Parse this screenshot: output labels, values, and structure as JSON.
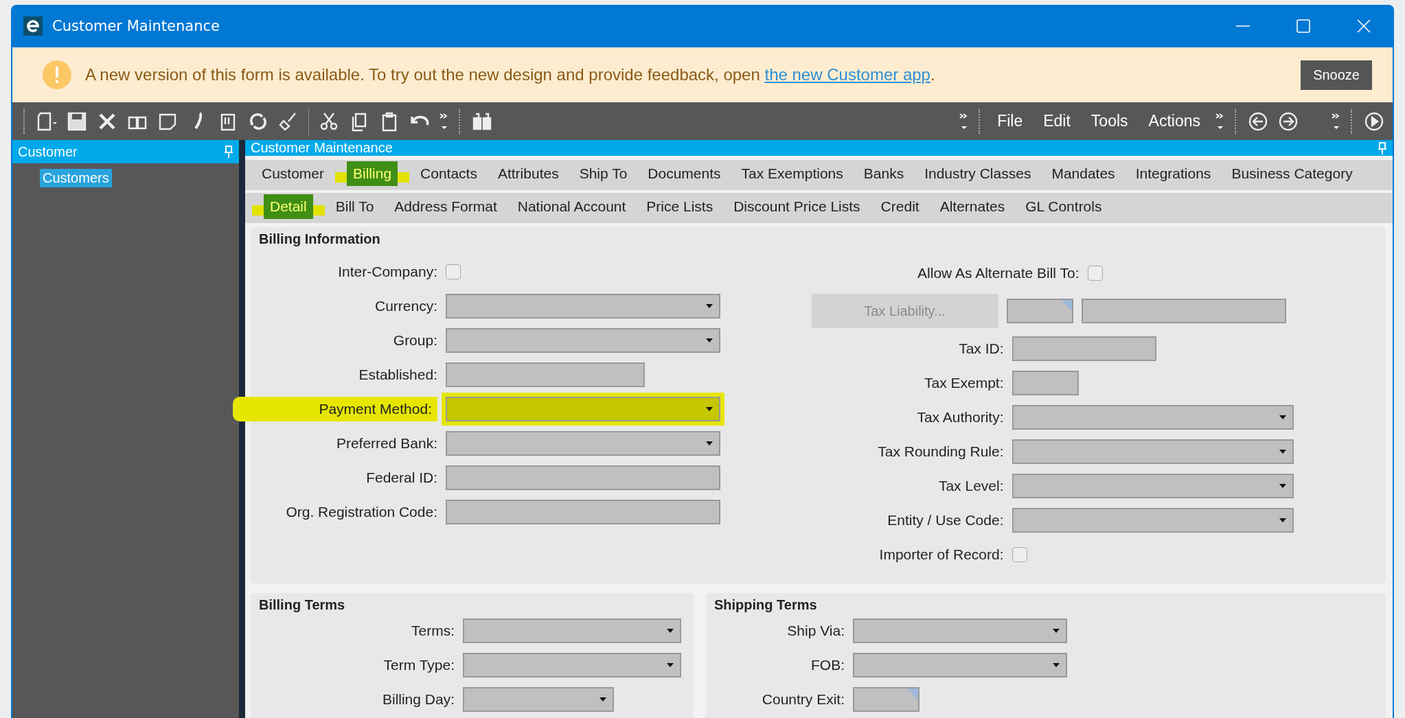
{
  "window": {
    "title": "Customer Maintenance"
  },
  "banner": {
    "message": "A new version of this form is available. To try out the new design and provide feedback, open ",
    "link": "the new Customer app",
    "after": ".",
    "button": "Snooze"
  },
  "toolbar": {
    "menus": [
      "File",
      "Edit",
      "Tools",
      "Actions"
    ]
  },
  "tree_panel": {
    "title": "Customer",
    "items": [
      {
        "label": "Customers",
        "selected": true
      }
    ]
  },
  "main_panel": {
    "title": "Customer Maintenance"
  },
  "tabs": [
    {
      "label": "Customer",
      "selected": false,
      "highlighted": false
    },
    {
      "label": "Billing",
      "selected": true,
      "highlighted": true
    },
    {
      "label": "Contacts",
      "selected": false,
      "highlighted": false
    },
    {
      "label": "Attributes",
      "selected": false,
      "highlighted": false
    },
    {
      "label": "Ship To",
      "selected": false,
      "highlighted": false
    },
    {
      "label": "Documents",
      "selected": false,
      "highlighted": false
    },
    {
      "label": "Tax Exemptions",
      "selected": false,
      "highlighted": false
    },
    {
      "label": "Banks",
      "selected": false,
      "highlighted": false
    },
    {
      "label": "Industry Classes",
      "selected": false,
      "highlighted": false
    },
    {
      "label": "Mandates",
      "selected": false,
      "highlighted": false
    },
    {
      "label": "Integrations",
      "selected": false,
      "highlighted": false
    },
    {
      "label": "Business Category",
      "selected": false,
      "highlighted": false
    }
  ],
  "subtabs": [
    {
      "label": "Detail",
      "selected": true,
      "highlighted": true
    },
    {
      "label": "Bill To",
      "selected": false,
      "highlighted": false
    },
    {
      "label": "Address Format",
      "selected": false,
      "highlighted": false
    },
    {
      "label": "National Account",
      "selected": false,
      "highlighted": false
    },
    {
      "label": "Price Lists",
      "selected": false,
      "highlighted": false
    },
    {
      "label": "Discount Price Lists",
      "selected": false,
      "highlighted": false
    },
    {
      "label": "Credit",
      "selected": false,
      "highlighted": false
    },
    {
      "label": "Alternates",
      "selected": false,
      "highlighted": false
    },
    {
      "label": "GL Controls",
      "selected": false,
      "highlighted": false
    }
  ],
  "billing_information": {
    "title": "Billing Information",
    "left_fields": [
      {
        "label": "Inter-Company:",
        "kind": "checkbox",
        "checked": false
      },
      {
        "label": "Currency:",
        "kind": "dropdown",
        "highlighted": false
      },
      {
        "label": "Group:",
        "kind": "dropdown",
        "highlighted": false
      },
      {
        "label": "Established:",
        "kind": "medium_text"
      },
      {
        "label": "Payment Method:",
        "kind": "dropdown",
        "highlighted": true
      },
      {
        "label": "Preferred Bank:",
        "kind": "dropdown",
        "highlighted": false
      },
      {
        "label": "Federal ID:",
        "kind": "text"
      },
      {
        "label": "Org. Registration Code:",
        "kind": "text"
      }
    ],
    "right_fields": [
      {
        "label": "Allow As Alternate Bill To:",
        "kind": "checkbox",
        "checked": false
      },
      {
        "button": "Tax Liability...",
        "kind": "button_row",
        "disabled": true
      },
      {
        "label": "Tax ID:",
        "kind": "medium_text"
      },
      {
        "label": "Tax Exempt:",
        "kind": "short_text"
      },
      {
        "label": "Tax Authority:",
        "kind": "dropdown",
        "highlighted": false
      },
      {
        "label": "Tax Rounding Rule:",
        "kind": "dropdown",
        "highlighted": false
      },
      {
        "label": "Tax Level:",
        "kind": "dropdown",
        "highlighted": false
      },
      {
        "label": "Entity / Use Code:",
        "kind": "dropdown",
        "highlighted": false
      },
      {
        "label": "Importer of Record:",
        "kind": "checkbox",
        "checked": false
      }
    ]
  },
  "billing_terms": {
    "title": "Billing Terms",
    "fields": [
      {
        "label": "Terms:",
        "kind": "dropdown",
        "highlighted": false
      },
      {
        "label": "Term Type:",
        "kind": "dropdown",
        "highlighted": false
      },
      {
        "label": "Billing Day:",
        "kind": "short_dropdown",
        "highlighted": false
      }
    ]
  },
  "shipping_terms": {
    "title": "Shipping Terms",
    "fields": [
      {
        "label": "Ship Via:",
        "kind": "dropdown",
        "highlighted": false
      },
      {
        "label": "FOB:",
        "kind": "dropdown",
        "highlighted": false
      },
      {
        "label": "Country Exit:",
        "kind": "code"
      }
    ]
  }
}
